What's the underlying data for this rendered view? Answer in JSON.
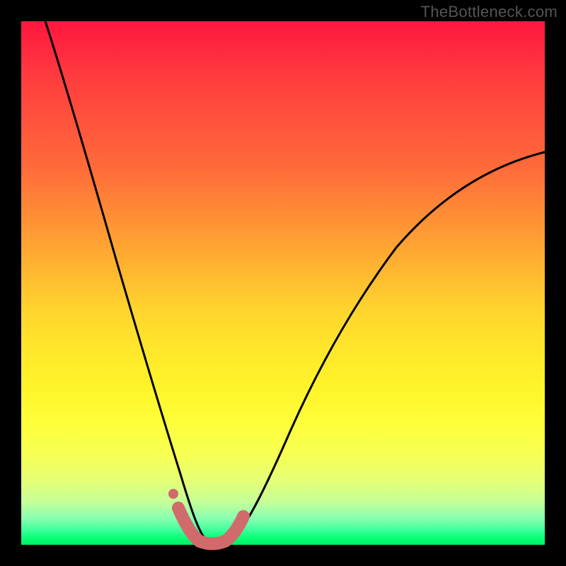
{
  "watermark": "TheBottleneck.com",
  "colors": {
    "curve": "#000000",
    "marker": "#d16b6b",
    "background_black": "#000000"
  },
  "chart_data": {
    "type": "line",
    "title": "",
    "xlabel": "",
    "ylabel": "",
    "xlim": [
      0,
      1
    ],
    "ylim": [
      0,
      1
    ],
    "note": "Bottleneck curve; no visible axis ticks or numeric labels. y=1 maps to top (high bottleneck, red), y=0 to bottom (no bottleneck, green). Minimum (optimal balance) near x≈0.35.",
    "series": [
      {
        "name": "bottleneck-curve",
        "x": [
          0.0,
          0.03,
          0.06,
          0.09,
          0.12,
          0.15,
          0.18,
          0.21,
          0.24,
          0.27,
          0.3,
          0.33,
          0.36,
          0.39,
          0.42,
          0.45,
          0.5,
          0.55,
          0.6,
          0.65,
          0.7,
          0.75,
          0.8,
          0.85,
          0.9,
          0.95,
          1.0
        ],
        "y": [
          1.0,
          0.92,
          0.83,
          0.73,
          0.63,
          0.53,
          0.43,
          0.33,
          0.24,
          0.15,
          0.07,
          0.02,
          0.0,
          0.01,
          0.04,
          0.09,
          0.18,
          0.27,
          0.35,
          0.42,
          0.49,
          0.55,
          0.6,
          0.65,
          0.69,
          0.72,
          0.75
        ]
      },
      {
        "name": "optimal-zone-markers",
        "x": [
          0.295,
          0.315,
          0.335,
          0.355,
          0.375,
          0.395,
          0.415
        ],
        "y": [
          0.055,
          0.025,
          0.01,
          0.005,
          0.01,
          0.025,
          0.05
        ]
      }
    ]
  }
}
